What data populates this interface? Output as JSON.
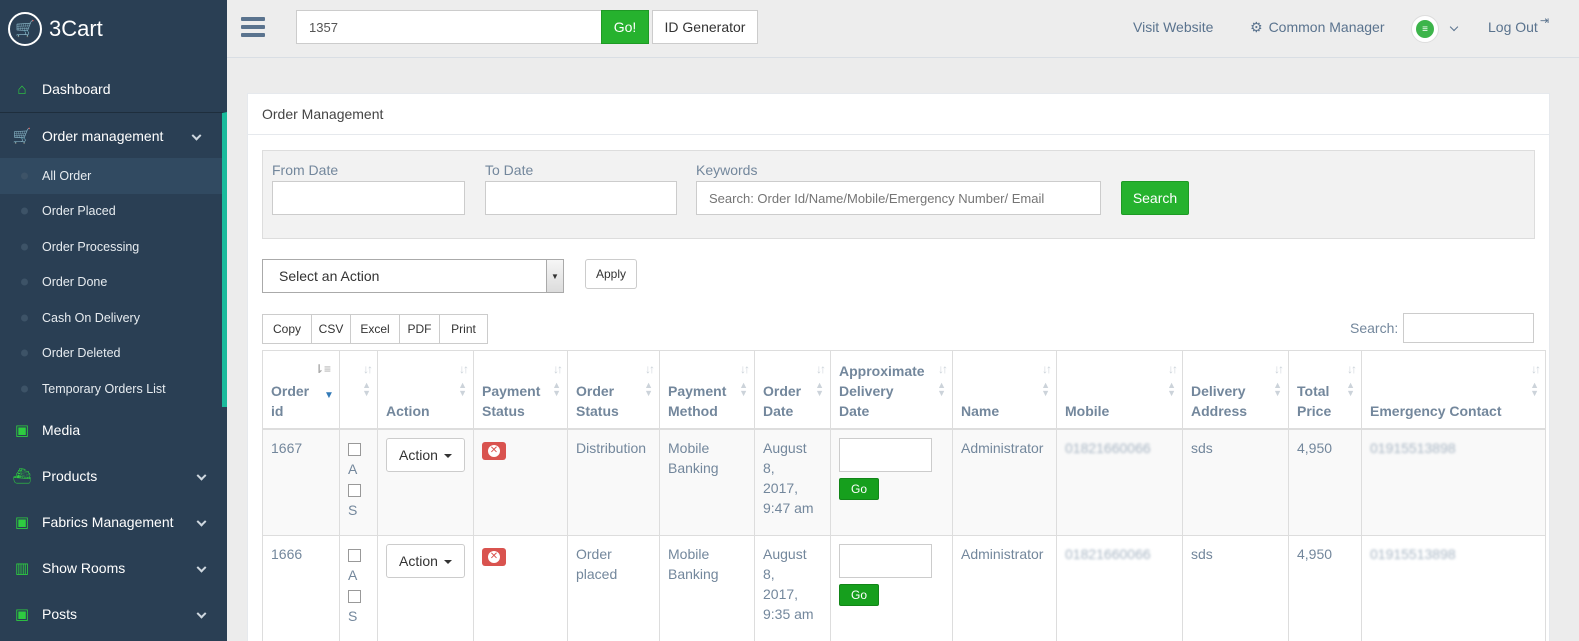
{
  "brand": {
    "name": "3Cart",
    "icon": "cart-icon"
  },
  "sidebar": {
    "items": [
      {
        "label": "Dashboard",
        "icon": "home-icon"
      },
      {
        "label": "Order management",
        "icon": "cart-add-icon"
      },
      {
        "label": "Media",
        "icon": "image-icon"
      },
      {
        "label": "Products",
        "icon": "ship-icon"
      },
      {
        "label": "Fabrics Management",
        "icon": "image-icon"
      },
      {
        "label": "Show Rooms",
        "icon": "building-icon"
      },
      {
        "label": "Posts",
        "icon": "image-icon"
      }
    ],
    "submenu": [
      "All Order",
      "Order Placed",
      "Order Processing",
      "Order Done",
      "Cash On Delivery",
      "Order Deleted",
      "Temporary Orders List"
    ]
  },
  "topbar": {
    "search_value": "1357",
    "go_label": "Go!",
    "idgen_label": "ID Generator",
    "visit_label": "Visit Website",
    "common_label": "Common Manager",
    "logout_label": "Log Out"
  },
  "panel": {
    "title": "Order Management",
    "filters": {
      "from_label": "From Date",
      "to_label": "To Date",
      "keywords_label": "Keywords",
      "keywords_placeholder": "Search: Order Id/Name/Mobile/Emergency Number/ Email",
      "search_label": "Search"
    },
    "bulk": {
      "select_label": "Select an Action",
      "apply_label": "Apply"
    },
    "export": [
      "Copy",
      "CSV",
      "Excel",
      "PDF",
      "Print"
    ],
    "table_search_label": "Search:"
  },
  "table": {
    "headers": {
      "order_id_1": "Order",
      "order_id_2": "id",
      "action": "Action",
      "payment_status_1": "Payment",
      "payment_status_2": "Status",
      "order_status_1": "Order",
      "order_status_2": "Status",
      "payment_method_1": "Payment",
      "payment_method_2": "Method",
      "order_date_1": "Order",
      "order_date_2": "Date",
      "delivery_1": "Approximate",
      "delivery_2": "Delivery",
      "delivery_3": "Date",
      "name": "Name",
      "mobile": "Mobile",
      "address_1": "Delivery",
      "address_2": "Address",
      "total_1": "Total",
      "total_2": "Price",
      "emergency": "Emergency Contact"
    },
    "check_a": "A",
    "check_s": "S",
    "action_btn": "Action",
    "go_btn": "Go",
    "rows": [
      {
        "order_id": "1667",
        "order_status_1": "Distribution",
        "order_status_2": "",
        "payment_method_1": "Mobile",
        "payment_method_2": "Banking",
        "date_1": "August 8,",
        "date_2": "2017,",
        "date_3": "9:47 am",
        "name": "Administrator",
        "mobile": "01821660066",
        "address": "sds",
        "total": "4,950",
        "emergency": "01915513898"
      },
      {
        "order_id": "1666",
        "order_status_1": "Order",
        "order_status_2": "placed",
        "payment_method_1": "Mobile",
        "payment_method_2": "Banking",
        "date_1": "August 8,",
        "date_2": "2017,",
        "date_3": "9:35 am",
        "name": "Administrator",
        "mobile": "01821660066",
        "address": "sds",
        "total": "4,950",
        "emergency": "01915513898"
      }
    ]
  },
  "colors": {
    "sidebar": "#2a3f54",
    "accent_green": "#26b22e",
    "active_border": "#1abb9c",
    "danger": "#d9534f"
  }
}
